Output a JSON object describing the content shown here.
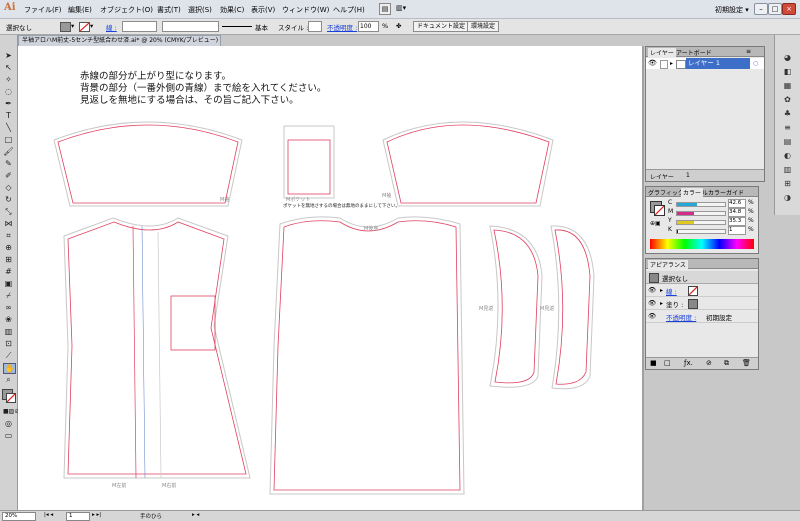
{
  "app": {
    "logo": "Ai",
    "menus": [
      "ファイル(F)",
      "編集(E)",
      "オブジェクト(O)",
      "書式(T)",
      "選択(S)",
      "効果(C)",
      "表示(V)",
      "ウィンドウ(W)",
      "ヘルプ(H)"
    ],
    "workspace": "初期設定 ▾"
  },
  "control_bar": {
    "selection": "選択なし",
    "stroke_label": "線 :",
    "stroke_style": "基本",
    "style_label": "スタイル :",
    "opacity_label": "不透明度 :",
    "opacity_value": "100",
    "opacity_unit": "%",
    "doc_settings": "ドキュメント設定",
    "preferences": "環境設定"
  },
  "document": {
    "tab_title": "半袖アロハM前丈-5センチ型紙合わせ済.ai* @ 20% (CMYK/プレビュー)",
    "tab_close": "⊠",
    "instructions": [
      "赤線の部分が上がり型になります。",
      "背景の部分（一番外側の青線）まで絵を入れてください。",
      "見返しを無地にする場合は、その旨ご記入下さい。"
    ],
    "piece_labels": {
      "sleeve_left": "M袖",
      "pocket": "Mポケット",
      "pocket_note": "ポケットを無地さするの場合は無地のままにして下さい。",
      "sleeve_right": "M袖",
      "front_left": "M左前",
      "front_right": "M右前",
      "back": "M後身",
      "facing_left": "M見返",
      "facing_right": "M見返"
    }
  },
  "layers_panel": {
    "tabs": [
      "レイヤー",
      "アートボード"
    ],
    "layer_name": "レイヤー 1",
    "footer_tabs": [
      "レイヤー",
      "1"
    ]
  },
  "color_panel": {
    "tabs": [
      "グラフィックスタイル",
      "カラー",
      "カラーガイド"
    ],
    "channels": [
      {
        "label": "C",
        "value": "42.6",
        "fill": 0.426,
        "color": "#25a8d8"
      },
      {
        "label": "M",
        "value": "34.8",
        "fill": 0.348,
        "color": "#d0308a"
      },
      {
        "label": "Y",
        "value": "35.3",
        "fill": 0.353,
        "color": "#e0c820"
      },
      {
        "label": "K",
        "value": "1",
        "fill": 0.01,
        "color": "#222222"
      }
    ],
    "unit": "%"
  },
  "appearance_panel": {
    "title": "アピアランス",
    "header": "選択なし",
    "rows": [
      "線 :",
      "塗り :",
      "不透明度 :"
    ],
    "opacity_value": "初期設定"
  },
  "status_bar": {
    "zoom": "20%",
    "page": "1",
    "tool": "手のひら"
  },
  "colors": {
    "cut_line": "#e04060",
    "bleed_line": "#5577cc",
    "sew_line": "#c0c0c0"
  }
}
